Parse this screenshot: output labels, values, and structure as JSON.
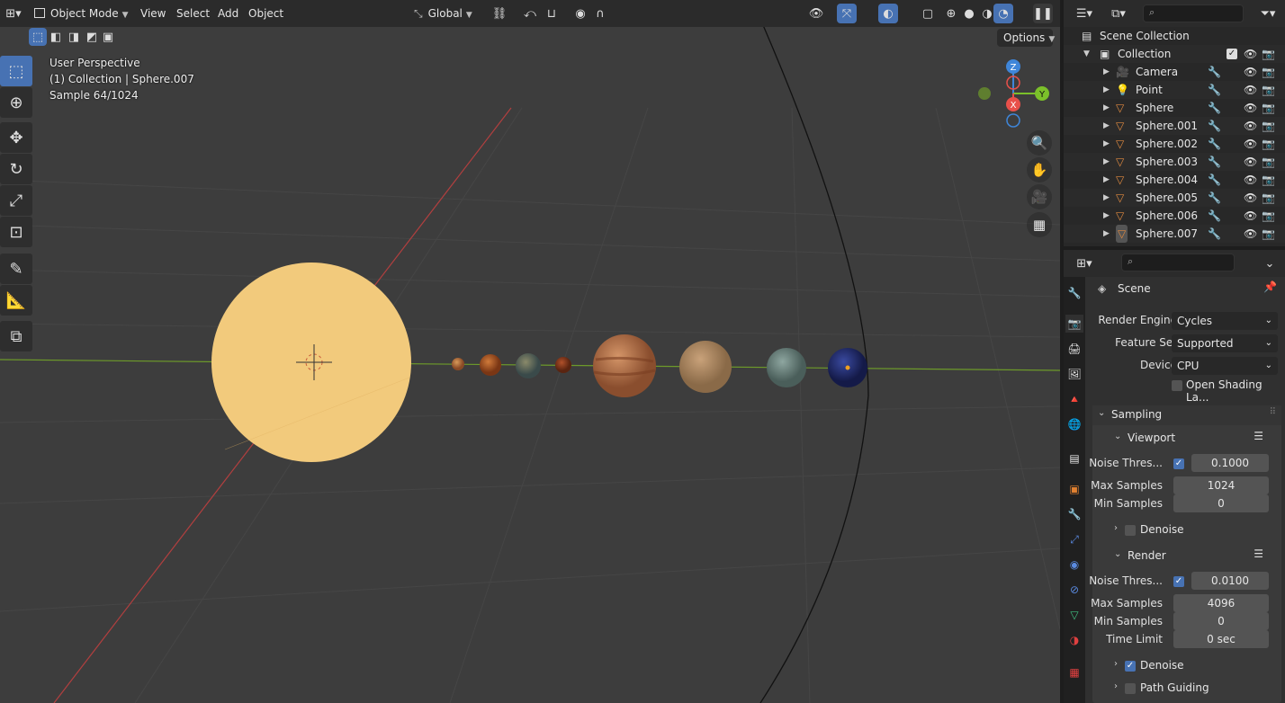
{
  "viewport_header": {
    "mode": "Object Mode",
    "menus": [
      "View",
      "Select",
      "Add",
      "Object"
    ],
    "orientation": "Global",
    "options_label": "Options"
  },
  "overlay": {
    "perspective": "User Perspective",
    "collection": "(1) Collection | Sphere.007",
    "sample": "Sample 64/1024"
  },
  "gizmo": {
    "x": "X",
    "y": "Y",
    "z": "Z"
  },
  "outliner": {
    "scene_collection": "Scene Collection",
    "collection": "Collection",
    "items": [
      {
        "label": "Camera",
        "icon": "camera-icon"
      },
      {
        "label": "Point",
        "icon": "light-icon"
      },
      {
        "label": "Sphere",
        "icon": "mesh-icon"
      },
      {
        "label": "Sphere.001",
        "icon": "mesh-icon"
      },
      {
        "label": "Sphere.002",
        "icon": "mesh-icon"
      },
      {
        "label": "Sphere.003",
        "icon": "mesh-icon"
      },
      {
        "label": "Sphere.004",
        "icon": "mesh-icon"
      },
      {
        "label": "Sphere.005",
        "icon": "mesh-icon"
      },
      {
        "label": "Sphere.006",
        "icon": "mesh-icon"
      },
      {
        "label": "Sphere.007",
        "icon": "mesh-icon"
      }
    ]
  },
  "properties": {
    "context": "Scene",
    "render_engine_label": "Render Engine",
    "render_engine": "Cycles",
    "feature_set_label": "Feature Set",
    "feature_set": "Supported",
    "device_label": "Device",
    "device": "CPU",
    "open_shading": "Open Shading La...",
    "sampling": "Sampling",
    "viewport": {
      "title": "Viewport",
      "noise_label": "Noise Thres...",
      "noise": "0.1000",
      "max_label": "Max Samples",
      "max": "1024",
      "min_label": "Min Samples",
      "min": "0",
      "denoise": "Denoise"
    },
    "render": {
      "title": "Render",
      "noise_label": "Noise Thres...",
      "noise": "0.0100",
      "max_label": "Max Samples",
      "max": "4096",
      "min_label": "Min Samples",
      "min": "0",
      "time_label": "Time Limit",
      "time": "0 sec",
      "denoise": "Denoise",
      "path_guiding": "Path Guiding"
    }
  },
  "colors": {
    "accent": "#4772b3",
    "sun": "#f2ca7c",
    "x_axis": "#e8504a",
    "y_axis": "#7bc02a",
    "z_axis": "#3f86d9"
  }
}
